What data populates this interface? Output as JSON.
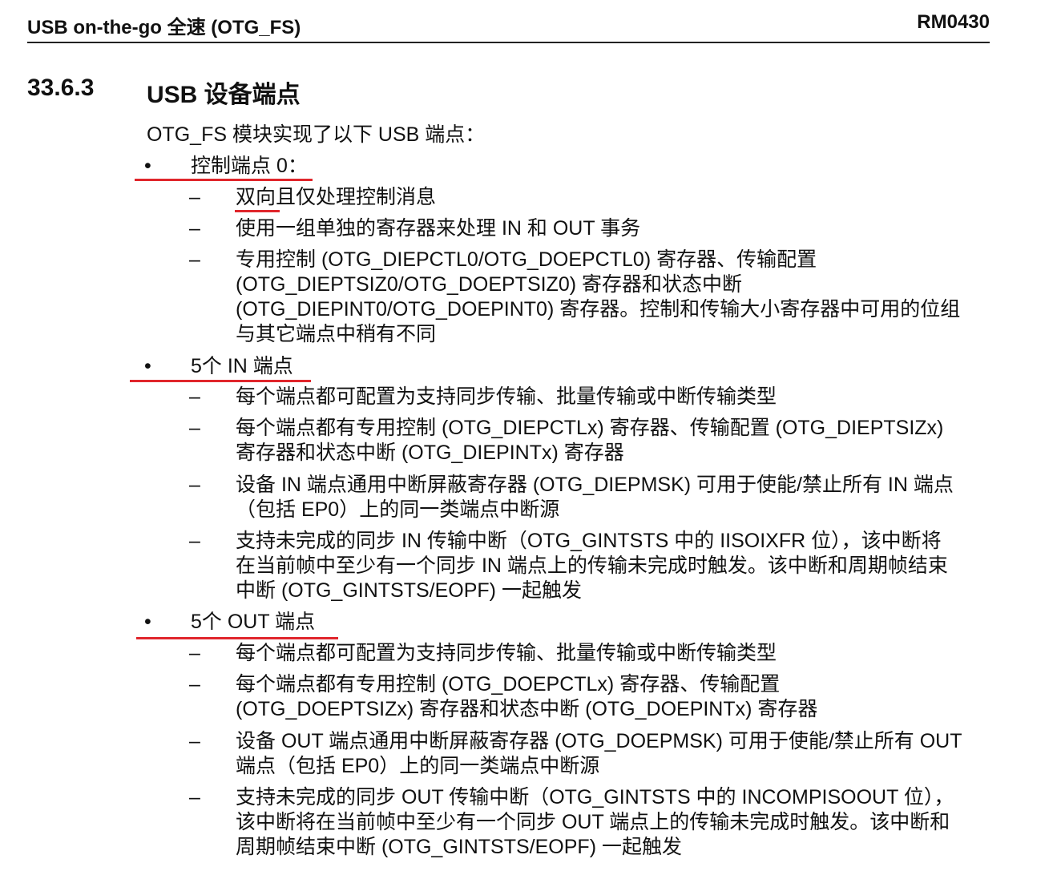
{
  "header": {
    "title": "USB on-the-go 全速 (OTG_FS)",
    "doc_id": "RM0430"
  },
  "section": {
    "number": "33.6.3",
    "title": "USB 设备端点"
  },
  "intro": "OTG_FS 模块实现了以下 USB 端点：",
  "bullets": [
    {
      "label": "控制端点 0：",
      "items": [
        {
          "lines": [
            "双向且仅处理控制消息"
          ]
        },
        {
          "lines": [
            "使用一组单独的寄存器来处理 IN 和 OUT 事务"
          ]
        },
        {
          "lines": [
            "专用控制 (OTG_DIEPCTL0/OTG_DOEPCTL0) 寄存器、传输配置",
            "(OTG_DIEPTSIZ0/OTG_DOEPTSIZ0) 寄存器和状态中断",
            "(OTG_DIEPINT0/OTG_DOEPINT0) 寄存器。控制和传输大小寄存器中可用的位组",
            "与其它端点中稍有不同"
          ]
        }
      ]
    },
    {
      "label": "5个 IN 端点",
      "items": [
        {
          "lines": [
            "每个端点都可配置为支持同步传输、批量传输或中断传输类型"
          ]
        },
        {
          "lines": [
            "每个端点都有专用控制 (OTG_DIEPCTLx) 寄存器、传输配置 (OTG_DIEPTSIZx)",
            "寄存器和状态中断 (OTG_DIEPINTx) 寄存器"
          ]
        },
        {
          "lines": [
            "设备 IN 端点通用中断屏蔽寄存器 (OTG_DIEPMSK) 可用于使能/禁止所有 IN 端点",
            "（包括 EP0）上的同一类端点中断源"
          ]
        },
        {
          "lines": [
            "支持未完成的同步 IN 传输中断（OTG_GINTSTS 中的 IISOIXFR 位），该中断将",
            "在当前帧中至少有一个同步 IN 端点上的传输未完成时触发。该中断和周期帧结束",
            "中断 (OTG_GINTSTS/EOPF) 一起触发"
          ]
        }
      ]
    },
    {
      "label": "5个 OUT 端点",
      "items": [
        {
          "lines": [
            "每个端点都可配置为支持同步传输、批量传输或中断传输类型"
          ]
        },
        {
          "lines": [
            "每个端点都有专用控制 (OTG_DOEPCTLx) 寄存器、传输配置",
            "(OTG_DOEPTSIZx) 寄存器和状态中断 (OTG_DOEPINTx) 寄存器"
          ]
        },
        {
          "lines": [
            "设备 OUT 端点通用中断屏蔽寄存器 (OTG_DOEPMSK) 可用于使能/禁止所有 OUT",
            "端点（包括 EP0）上的同一类端点中断源"
          ]
        },
        {
          "lines": [
            "支持未完成的同步 OUT 传输中断（OTG_GINTSTS 中的 INCOMPISOOUT 位），",
            "该中断将在当前帧中至少有一个同步 OUT 端点上的传输未完成时触发。该中断和",
            "周期帧结束中断 (OTG_GINTSTS/EOPF) 一起触发"
          ]
        }
      ]
    }
  ],
  "bullet_glyph": "•",
  "dash_glyph": "–",
  "annotation_color": "#e0262c"
}
